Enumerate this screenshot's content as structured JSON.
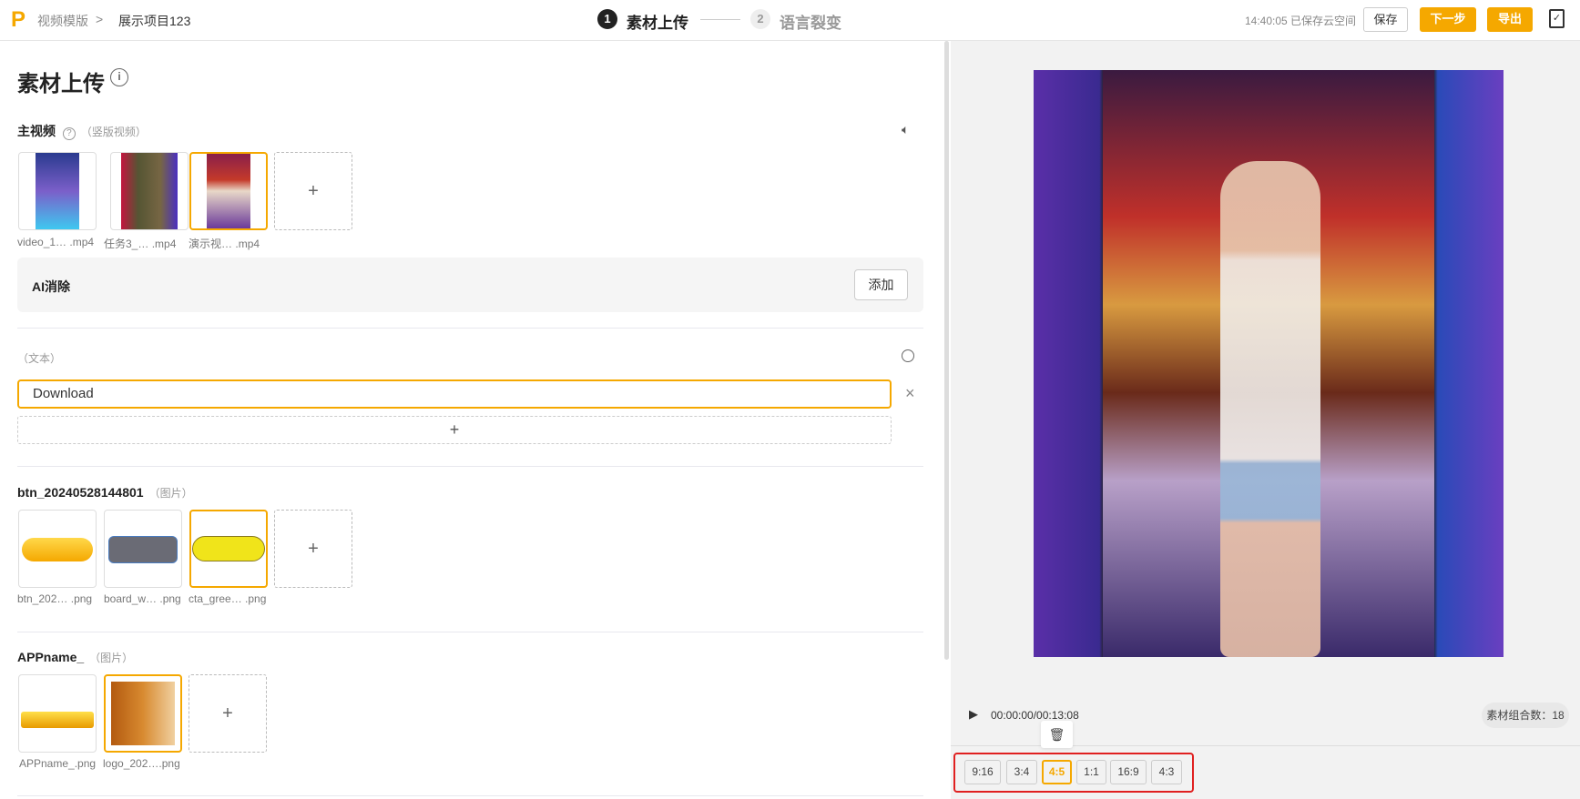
{
  "header": {
    "breadcrumb_root": "视频模版",
    "breadcrumb_sep": ">",
    "project": "展示项目123",
    "steps": [
      {
        "num": "1",
        "label": "素材上传"
      },
      {
        "num": "2",
        "label": "语言裂变"
      }
    ],
    "save_status": "14:40:05 已保存云空间",
    "save": "保存",
    "next": "下一步",
    "export": "导出"
  },
  "main": {
    "title": "素材上传",
    "info": "i",
    "video": {
      "label": "主视频",
      "help": "?",
      "hint": "（竖版视频）",
      "files": [
        [
          "video_1…",
          ".mp4"
        ],
        [
          "任务3_…",
          ".mp4"
        ],
        [
          "演示视…",
          ".mp4"
        ]
      ],
      "add": "+"
    },
    "ai": {
      "label": "AI消除",
      "button": "添加"
    },
    "text": {
      "hint": "（文本）",
      "value": "Download",
      "close": "×",
      "add": "+"
    },
    "btn": {
      "label": "btn_20240528144801",
      "hint": "（图片）",
      "files": [
        [
          "btn_202…",
          ".png"
        ],
        [
          "board_w…",
          ".png"
        ],
        [
          "cta_gree…",
          ".png"
        ]
      ],
      "add": "+"
    },
    "app": {
      "label": "APPname_",
      "hint": "（图片）",
      "files": [
        [
          "APPname_",
          ".png"
        ],
        [
          "logo_202…",
          ".png"
        ]
      ],
      "add": "+"
    }
  },
  "preview": {
    "time": "00:00:00/00:13:08",
    "combo_label": "素材组合数：",
    "combo": "18",
    "ratios": [
      "9:16",
      "3:4",
      "4:5",
      "1:1",
      "16:9",
      "4:3"
    ],
    "active_ratio": "4:5"
  },
  "colors": {
    "accent": "#f5a800",
    "highlight": "#e02020"
  }
}
